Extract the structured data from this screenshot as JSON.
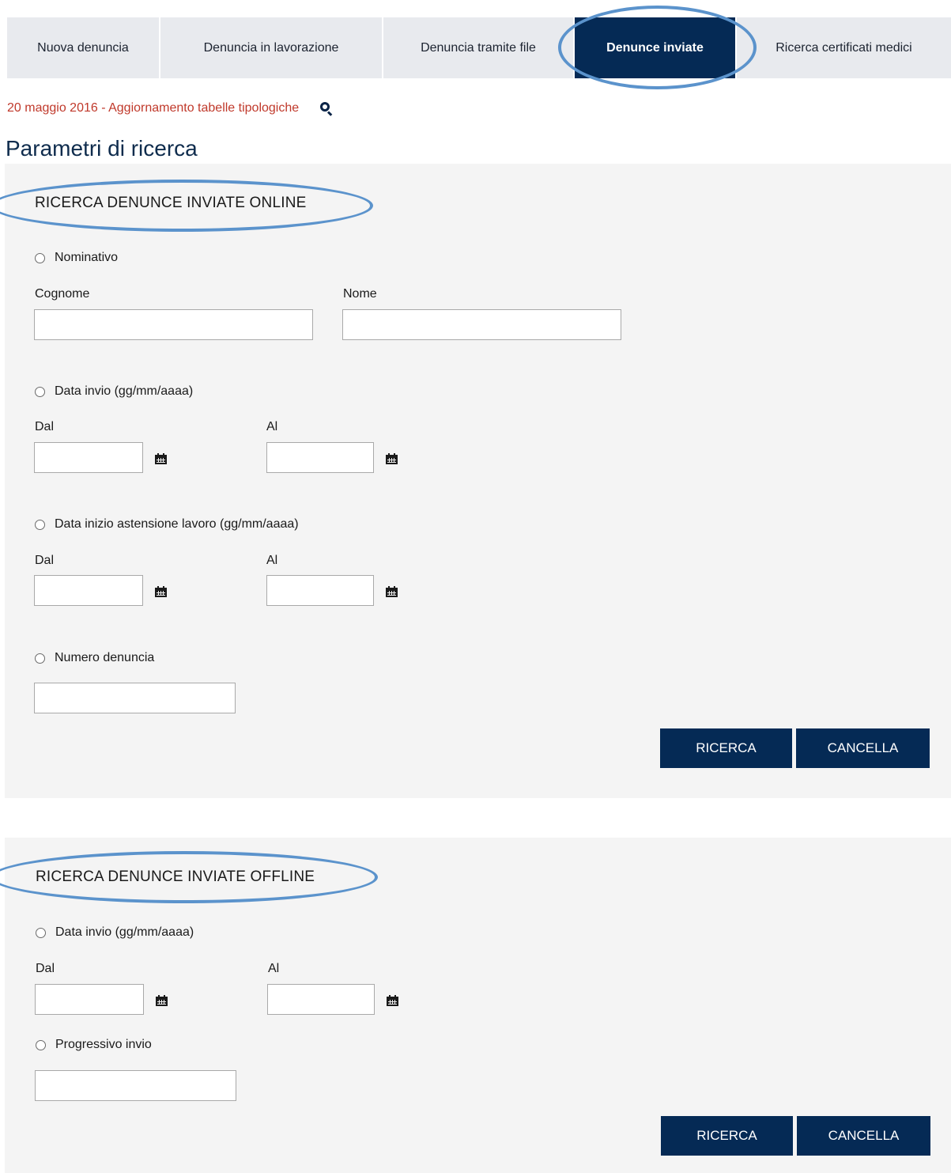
{
  "tabs": [
    {
      "label": "Nuova denuncia"
    },
    {
      "label": "Denuncia in lavorazione"
    },
    {
      "label": "Denuncia tramite file"
    },
    {
      "label": "Denunce inviate"
    },
    {
      "label": "Ricerca certificati medici"
    }
  ],
  "active_tab": "Denunce inviate",
  "notice": {
    "text": "20 maggio 2016 - Aggiornamento tabelle tipologiche"
  },
  "page_title": "Parametri di ricerca",
  "online": {
    "title": "RICERCA DENUNCE INVIATE ONLINE",
    "nominativo": {
      "option": "Nominativo",
      "cognome_label": "Cognome",
      "nome_label": "Nome"
    },
    "data_invio": {
      "option": "Data invio (gg/mm/aaaa)",
      "dal_label": "Dal",
      "al_label": "Al"
    },
    "data_inizio": {
      "option": "Data inizio astensione lavoro (gg/mm/aaaa)",
      "dal_label": "Dal",
      "al_label": "Al"
    },
    "numero": {
      "option": "Numero denuncia"
    },
    "search_button": "RICERCA",
    "cancel_button": "CANCELLA"
  },
  "offline": {
    "title": "RICERCA DENUNCE INVIATE OFFLINE",
    "data_invio": {
      "option": "Data invio (gg/mm/aaaa)",
      "dal_label": "Dal",
      "al_label": "Al"
    },
    "progressivo": {
      "option": "Progressivo invio"
    },
    "search_button": "RICERCA",
    "cancel_button": "CANCELLA"
  },
  "colors": {
    "primary": "#052a55",
    "highlight": "#5b93cc",
    "notice": "#c0392b",
    "panel": "#f4f4f4"
  },
  "icons": {
    "search": "search-icon",
    "calendar": "calendar-icon"
  }
}
